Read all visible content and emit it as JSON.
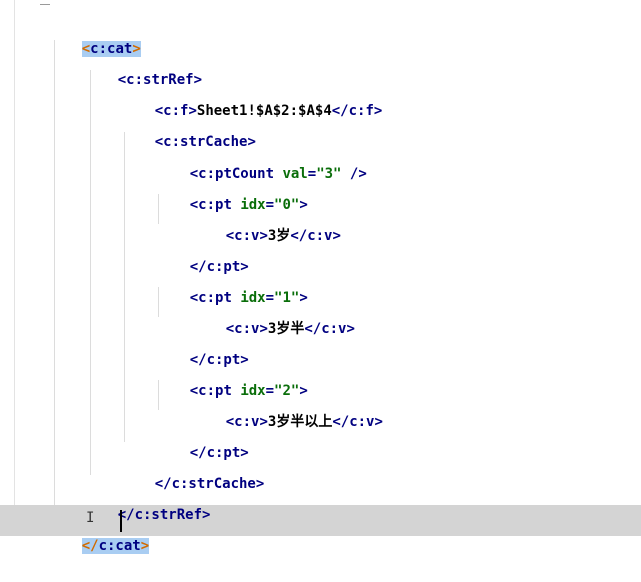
{
  "code": {
    "l1": {
      "open": "<",
      "tag": "c:cat",
      "close": ">"
    },
    "l2": {
      "open": "<",
      "tag": "c:strRef",
      "close": ">"
    },
    "l3": {
      "open": "<",
      "tag": "c:f",
      "close": ">",
      "text": "Sheet1!$A$2:$A$4",
      "eopen": "</",
      "etag": "c:f",
      "eclose": ">"
    },
    "l4": {
      "open": "<",
      "tag": "c:strCache",
      "close": ">"
    },
    "l5": {
      "open": "<",
      "tag": "c:ptCount",
      "attr": "val",
      "eq": "=",
      "val": "\"3\"",
      "close": " />"
    },
    "l6": {
      "open": "<",
      "tag": "c:pt",
      "attr": "idx",
      "eq": "=",
      "val": "\"0\"",
      "close": ">"
    },
    "l7": {
      "open": "<",
      "tag": "c:v",
      "close": ">",
      "text": "3岁",
      "eopen": "</",
      "etag": "c:v",
      "eclose": ">"
    },
    "l8": {
      "open": "</",
      "tag": "c:pt",
      "close": ">"
    },
    "l9": {
      "open": "<",
      "tag": "c:pt",
      "attr": "idx",
      "eq": "=",
      "val": "\"1\"",
      "close": ">"
    },
    "l10": {
      "open": "<",
      "tag": "c:v",
      "close": ">",
      "text": "3岁半",
      "eopen": "</",
      "etag": "c:v",
      "eclose": ">"
    },
    "l11": {
      "open": "</",
      "tag": "c:pt",
      "close": ">"
    },
    "l12": {
      "open": "<",
      "tag": "c:pt",
      "attr": "idx",
      "eq": "=",
      "val": "\"2\"",
      "close": ">"
    },
    "l13": {
      "open": "<",
      "tag": "c:v",
      "close": ">",
      "text": "3岁半以上",
      "eopen": "</",
      "etag": "c:v",
      "eclose": ">"
    },
    "l14": {
      "open": "</",
      "tag": "c:pt",
      "close": ">"
    },
    "l15": {
      "open": "</",
      "tag": "c:strCache",
      "close": ">"
    },
    "l16": {
      "open": "</",
      "tag": "c:strRef",
      "close": ">"
    },
    "l17": {
      "open": "</",
      "tag": "c:cat",
      "close": ">"
    }
  },
  "colors": {
    "tag": "#000080",
    "attribute": "#0a6e0a",
    "string": "#0a6e0a",
    "match_highlight": "#a9cdf2",
    "current_line": "#d4d4d4"
  },
  "icons": {
    "cursor": "text-cursor-icon",
    "mouse": "ibeam-pointer-icon"
  }
}
